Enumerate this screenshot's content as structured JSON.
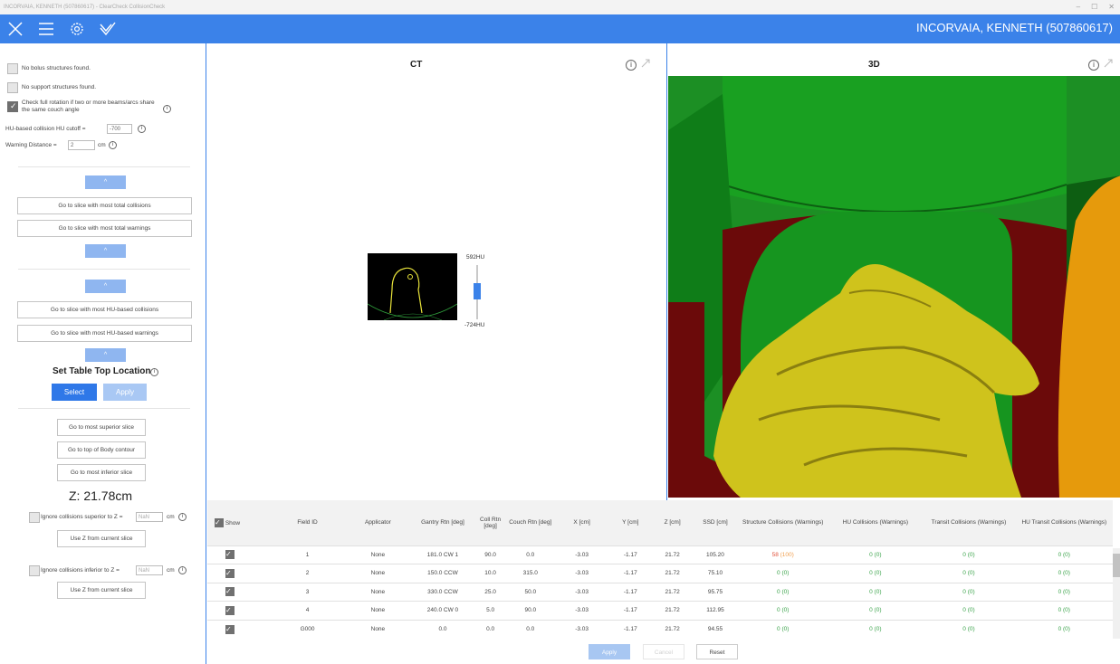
{
  "window": {
    "title": "INCORVAIA, KENNETH (507860617) - ClearCheck CollisionCheck",
    "controls": [
      "–",
      "☐",
      "✕"
    ]
  },
  "toolbar": {
    "patient": "INCORVAIA, KENNETH (507860617)",
    "accent": "#3b82e9",
    "icons": [
      "close-icon",
      "menu-icon",
      "gear-icon",
      "check-icon"
    ]
  },
  "sidebar": {
    "no_bolus": "No bolus structures found.",
    "no_support": "No support structures found.",
    "check_rotation": "Check full rotation if two or more beams/arcs share the same couch angle",
    "hu_cutoff_label": "HU-based collision HU cutoff =",
    "hu_cutoff_value": "-700",
    "warning_distance_label": "Warning Distance =",
    "warning_distance_value": "2",
    "warning_distance_unit": "cm",
    "collapse1": "^",
    "goto_total_collisions": "Go to slice with most total collisions",
    "goto_total_warnings": "Go to slice with most total warnings",
    "collapse2": "^",
    "collapse3": "^",
    "goto_hu_collisions": "Go to slice with most HU-based collisions",
    "goto_hu_warnings": "Go to slice with most HU-based warnings",
    "collapse4": "^",
    "table_top_title": "Set Table Top Location",
    "select": "Select",
    "apply": "Apply",
    "goto_superior": "Go to most superior slice",
    "goto_top_body": "Go to top of Body contour",
    "goto_inferior": "Go to most inferior slice",
    "z_value": "Z: 21.78cm",
    "ignore_superior": "Ignore collisions superior to Z =",
    "ignore_inferior": "Ignore collisions inferior to Z =",
    "nan_placeholder": "NaN",
    "cm": "cm",
    "use_z_1": "Use Z from current slice",
    "use_z_2": "Use Z from current slice"
  },
  "ct": {
    "title": "CT",
    "hu_max": "592HU",
    "hu_min": "-724HU"
  },
  "view3d": {
    "title": "3D"
  },
  "grid": {
    "headers": [
      "Show",
      "Field ID",
      "Applicator",
      "Gantry Rtn [deg]",
      "Coll Rtn [deg]",
      "Couch Rtn [deg]",
      "X [cm]",
      "Y [cm]",
      "Z [cm]",
      "SSD [cm]",
      "Structure Collisions (Warnings)",
      "HU Collisions (Warnings)",
      "Transit Collisions (Warnings)",
      "HU Transit Collisions (Warnings)"
    ],
    "rows": [
      {
        "field": "1",
        "app": "None",
        "gantry": "181.0 CW 1",
        "coll": "90.0",
        "couch": "0.0",
        "x": "-3.03",
        "y": "-1.17",
        "z": "21.72",
        "ssd": "105.20",
        "sc": "58",
        "scw": "(100)",
        "hu": "0 (0)",
        "tr": "0 (0)",
        "hut": "0 (0)"
      },
      {
        "field": "2",
        "app": "None",
        "gantry": "150.0 CCW",
        "coll": "10.0",
        "couch": "315.0",
        "x": "-3.03",
        "y": "-1.17",
        "z": "21.72",
        "ssd": "75.10",
        "sc": "0",
        "scw": "(0)",
        "hu": "0 (0)",
        "tr": "0 (0)",
        "hut": "0 (0)"
      },
      {
        "field": "3",
        "app": "None",
        "gantry": "330.0 CCW",
        "coll": "25.0",
        "couch": "50.0",
        "x": "-3.03",
        "y": "-1.17",
        "z": "21.72",
        "ssd": "95.75",
        "sc": "0",
        "scw": "(0)",
        "hu": "0 (0)",
        "tr": "0 (0)",
        "hut": "0 (0)"
      },
      {
        "field": "4",
        "app": "None",
        "gantry": "240.0 CW 0",
        "coll": "5.0",
        "couch": "90.0",
        "x": "-3.03",
        "y": "-1.17",
        "z": "21.72",
        "ssd": "112.95",
        "sc": "0",
        "scw": "(0)",
        "hu": "0 (0)",
        "tr": "0 (0)",
        "hut": "0 (0)"
      },
      {
        "field": "G000",
        "app": "None",
        "gantry": "0.0",
        "coll": "0.0",
        "couch": "0.0",
        "x": "-3.03",
        "y": "-1.17",
        "z": "21.72",
        "ssd": "94.55",
        "sc": "0",
        "scw": "(0)",
        "hu": "0 (0)",
        "tr": "0 (0)",
        "hut": "0 (0)"
      }
    ],
    "collision_color": "#e2533c",
    "ok_color": "#3aa34a"
  },
  "footer": {
    "apply": "Apply",
    "cancel": "Cancel",
    "reset": "Reset"
  }
}
